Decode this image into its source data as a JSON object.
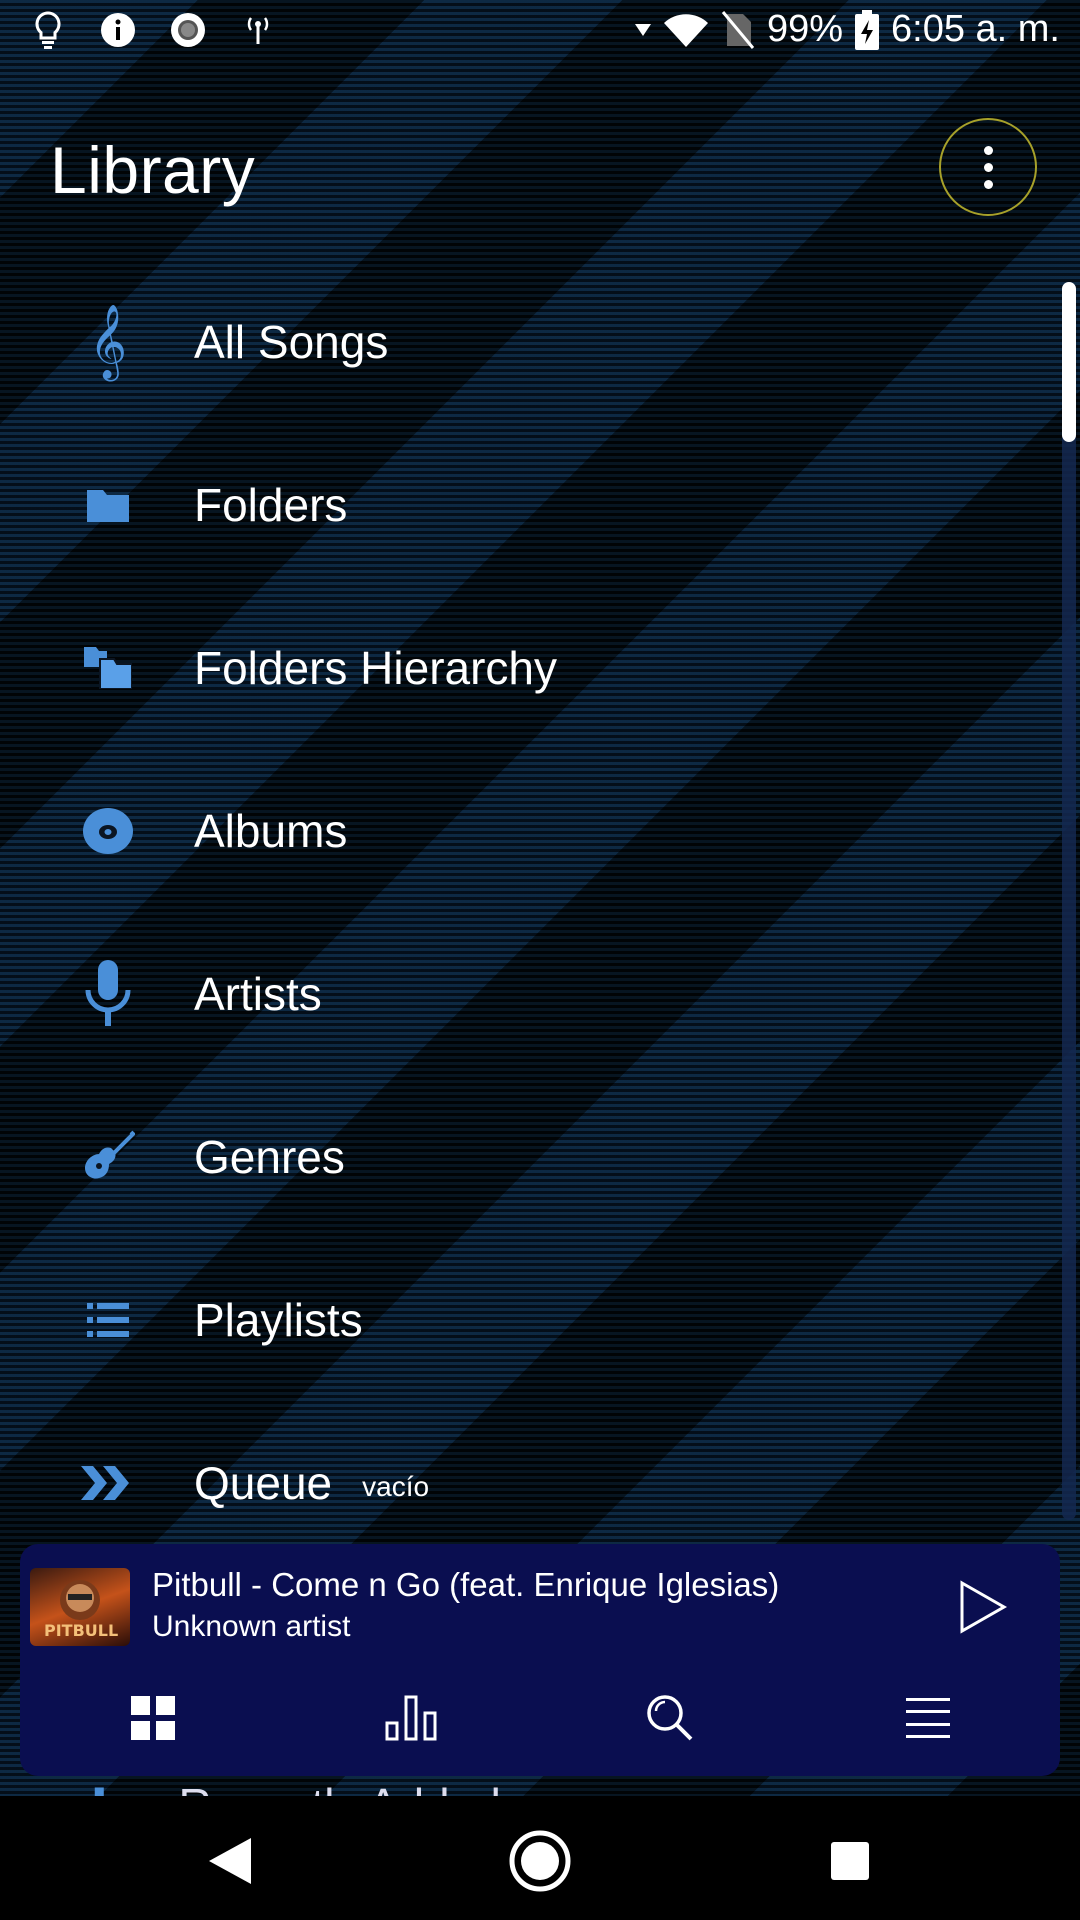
{
  "status_bar": {
    "left_icons": [
      "bulb-icon",
      "info-icon",
      "record-icon",
      "antenna-icon"
    ],
    "battery": "99%",
    "time": "6:05 a. m."
  },
  "header": {
    "title": "Library",
    "menu_icon": "more-vert-icon"
  },
  "colors": {
    "accent_icon": "#4a8fd8",
    "player_bg": "#0a0e50",
    "menu_ring": "#a7a12a"
  },
  "library_items": [
    {
      "label": "All Songs",
      "icon": "treble-clef-icon"
    },
    {
      "label": "Folders",
      "icon": "folder-icon"
    },
    {
      "label": "Folders Hierarchy",
      "icon": "folders-hierarchy-icon"
    },
    {
      "label": "Albums",
      "icon": "disc-icon"
    },
    {
      "label": "Artists",
      "icon": "microphone-icon"
    },
    {
      "label": "Genres",
      "icon": "guitar-icon"
    },
    {
      "label": "Playlists",
      "icon": "list-icon"
    },
    {
      "label": "Queue",
      "icon": "queue-arrows-icon",
      "sub": "vacío"
    }
  ],
  "peek_item": {
    "label": "Recently Added",
    "icon": "plus-icon"
  },
  "now_playing": {
    "song": "Pitbull - Come n Go (feat. Enrique Iglesias)",
    "artist": "Unknown artist",
    "art_text": "PITBULL"
  },
  "bottom_nav": [
    "grid-icon",
    "bar-chart-icon",
    "search-icon",
    "menu-lines-icon"
  ],
  "system_nav": [
    "back-icon",
    "home-icon",
    "recents-icon"
  ]
}
